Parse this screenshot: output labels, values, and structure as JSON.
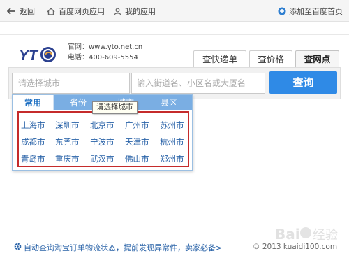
{
  "topbar": {
    "back_label": "返回",
    "home_label": "百度网页应用",
    "my_apps_label": "我的应用",
    "add_home_label": "添加至百度首页"
  },
  "header": {
    "logo_text": "YT",
    "website_label": "官网：",
    "website_value": "www.yto.net.cn",
    "phone_label": "电话：",
    "phone_value": "400-609-5554"
  },
  "tabs": [
    {
      "label": "查快递单"
    },
    {
      "label": "查价格"
    },
    {
      "label": "查网点",
      "active": true
    }
  ],
  "search": {
    "city_placeholder": "请选择城市",
    "street_placeholder": "输入街道名、小区名或大厦名",
    "query_label": "查询"
  },
  "dropdown": {
    "tabs": [
      "常用",
      "省份",
      "城市",
      "县区"
    ],
    "active_tab": "常用",
    "tooltip": "请选择城市",
    "cities": [
      [
        "上海市",
        "深圳市",
        "北京市",
        "广州市",
        "苏州市"
      ],
      [
        "成都市",
        "东莞市",
        "宁波市",
        "天津市",
        "杭州市"
      ],
      [
        "青岛市",
        "重庆市",
        "武汉市",
        "佛山市",
        "郑州市"
      ]
    ]
  },
  "footer": {
    "link": "自动查询淘宝订单物流状态，提前发现异常件，卖家必备>",
    "copyright": "© 2013 kuaidi100.com"
  },
  "colors": {
    "accent_blue": "#2f8ae6",
    "tab_blue": "#7aaee3",
    "highlight_red": "#c52b2b",
    "link_blue": "#2a63a8"
  }
}
